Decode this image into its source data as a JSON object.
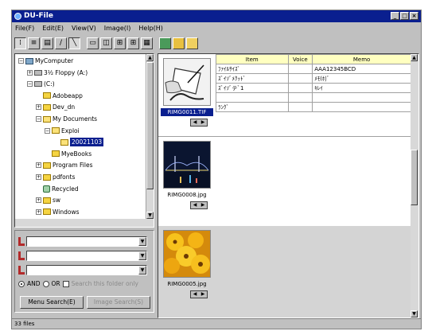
{
  "window": {
    "title": "DU-File"
  },
  "menu": [
    "File(F)",
    "Edit(E)",
    "View(V)",
    "Image(I)",
    "Help(H)"
  ],
  "tree": [
    {
      "label": "MyComputer",
      "icon": "computer-icon",
      "depth": 0,
      "exp": "−"
    },
    {
      "label": "3½ Floppy (A:)",
      "icon": "floppy-drive-icon",
      "depth": 1,
      "exp": "+"
    },
    {
      "label": "(C:)",
      "icon": "hard-drive-icon",
      "depth": 1,
      "exp": "−"
    },
    {
      "label": "Adobeapp",
      "icon": "folder-icon",
      "depth": 2,
      "exp": ""
    },
    {
      "label": "Dev_dn",
      "icon": "folder-icon",
      "depth": 2,
      "exp": "+"
    },
    {
      "label": "My Documents",
      "icon": "folder-open-icon",
      "depth": 2,
      "exp": "−"
    },
    {
      "label": "Exploi",
      "icon": "folder-open-icon",
      "depth": 3,
      "exp": "−"
    },
    {
      "label": "20021103",
      "icon": "folder-open-icon",
      "depth": 4,
      "exp": "",
      "selected": true
    },
    {
      "label": "MyeBooks",
      "icon": "folder-icon",
      "depth": 3,
      "exp": ""
    },
    {
      "label": "Program Files",
      "icon": "folder-icon",
      "depth": 2,
      "exp": "+"
    },
    {
      "label": "pdfonts",
      "icon": "folder-icon",
      "depth": 2,
      "exp": "+"
    },
    {
      "label": "Recycled",
      "icon": "recycle-bin-icon",
      "depth": 2,
      "exp": ""
    },
    {
      "label": "sw",
      "icon": "folder-icon",
      "depth": 2,
      "exp": "+"
    },
    {
      "label": "Windows",
      "icon": "folder-icon",
      "depth": 2,
      "exp": "+"
    }
  ],
  "search": {
    "and_label": "AND",
    "or_label": "OR",
    "option_label": "Search this folder only",
    "menu_search_button": "Menu Search(E)",
    "image_search_button": "Image Search(S)"
  },
  "entries": [
    {
      "filename": "RIMG0011.TIF",
      "selected": true,
      "rows": [
        {
          "item": "ﾌｧｲﾙｻｲｽﾞ",
          "voice": "",
          "memo": "AAA12345BCD"
        },
        {
          "item": "ｽﾞｲｿﾞﾒｸｯﾄﾞ",
          "voice": "",
          "memo": "ﾒﾓ(ﾎ)ﾞ"
        },
        {
          "item": "ｽﾞｲｿﾞテﾞ1",
          "voice": "",
          "memo": "ｷﾚｲ"
        },
        {
          "item": "",
          "voice": "",
          "memo": ""
        },
        {
          "item": "ﾗﾝｸﾞ",
          "voice": "",
          "memo": ""
        }
      ]
    },
    {
      "filename": "RIMG0008.jpg",
      "selected": false,
      "rows": []
    },
    {
      "filename": "RIMG0005.jpg",
      "selected": false,
      "rows": []
    }
  ],
  "table_headers": {
    "item": "Item",
    "voice": "Voice",
    "memo": "Memo"
  },
  "status": "33 files",
  "colors": {
    "titlebar": "#0a1f8f",
    "window_bg": "#c0c0c0",
    "header_bg": "#ffffc0"
  }
}
